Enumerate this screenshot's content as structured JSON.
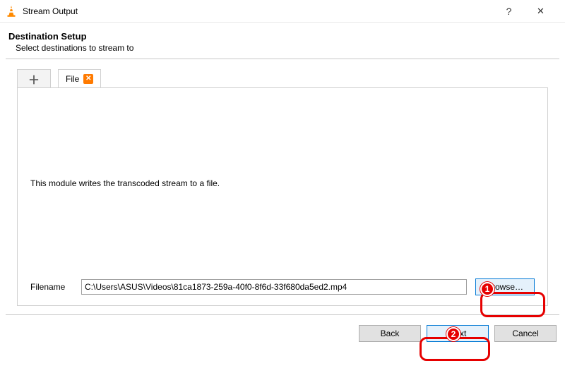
{
  "titlebar": {
    "title": "Stream Output",
    "help_symbol": "?",
    "close_symbol": "✕"
  },
  "header": {
    "title": "Destination Setup",
    "subtitle": "Select destinations to stream to"
  },
  "tabs": {
    "add_symbol": "＋",
    "items": [
      {
        "label": "File",
        "closable": true,
        "close_symbol": "✕"
      }
    ]
  },
  "panel": {
    "description": "This module writes the transcoded stream to a file.",
    "filename_label": "Filename",
    "filename_value": "C:\\Users\\ASUS\\Videos\\81ca1873-259a-40f0-8f6d-33f680da5ed2.mp4",
    "browse_label": "Browse…"
  },
  "footer": {
    "back": "Back",
    "next": "Next",
    "cancel": "Cancel"
  },
  "annotations": {
    "badge1": "1",
    "badge2": "2"
  }
}
